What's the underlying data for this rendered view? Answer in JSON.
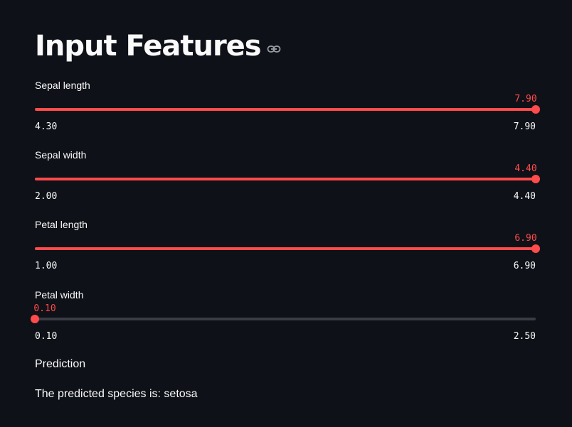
{
  "header": {
    "title": "Input Features",
    "anchor_icon": "link-icon"
  },
  "sliders": [
    {
      "label": "Sepal length",
      "min": 4.3,
      "max": 7.9,
      "value": 7.9,
      "min_text": "4.30",
      "max_text": "7.90",
      "value_text": "7.90"
    },
    {
      "label": "Sepal width",
      "min": 2.0,
      "max": 4.4,
      "value": 4.4,
      "min_text": "2.00",
      "max_text": "4.40",
      "value_text": "4.40"
    },
    {
      "label": "Petal length",
      "min": 1.0,
      "max": 6.9,
      "value": 6.9,
      "min_text": "1.00",
      "max_text": "6.90",
      "value_text": "6.90"
    },
    {
      "label": "Petal width",
      "min": 0.1,
      "max": 2.5,
      "value": 0.1,
      "min_text": "0.10",
      "max_text": "2.50",
      "value_text": "0.10"
    }
  ],
  "prediction": {
    "heading": "Prediction",
    "text": "The predicted species is: setosa"
  },
  "colors": {
    "background": "#0e1117",
    "accent": "#ff4b4b",
    "track": "#3a3c44",
    "text": "#fafafa"
  }
}
